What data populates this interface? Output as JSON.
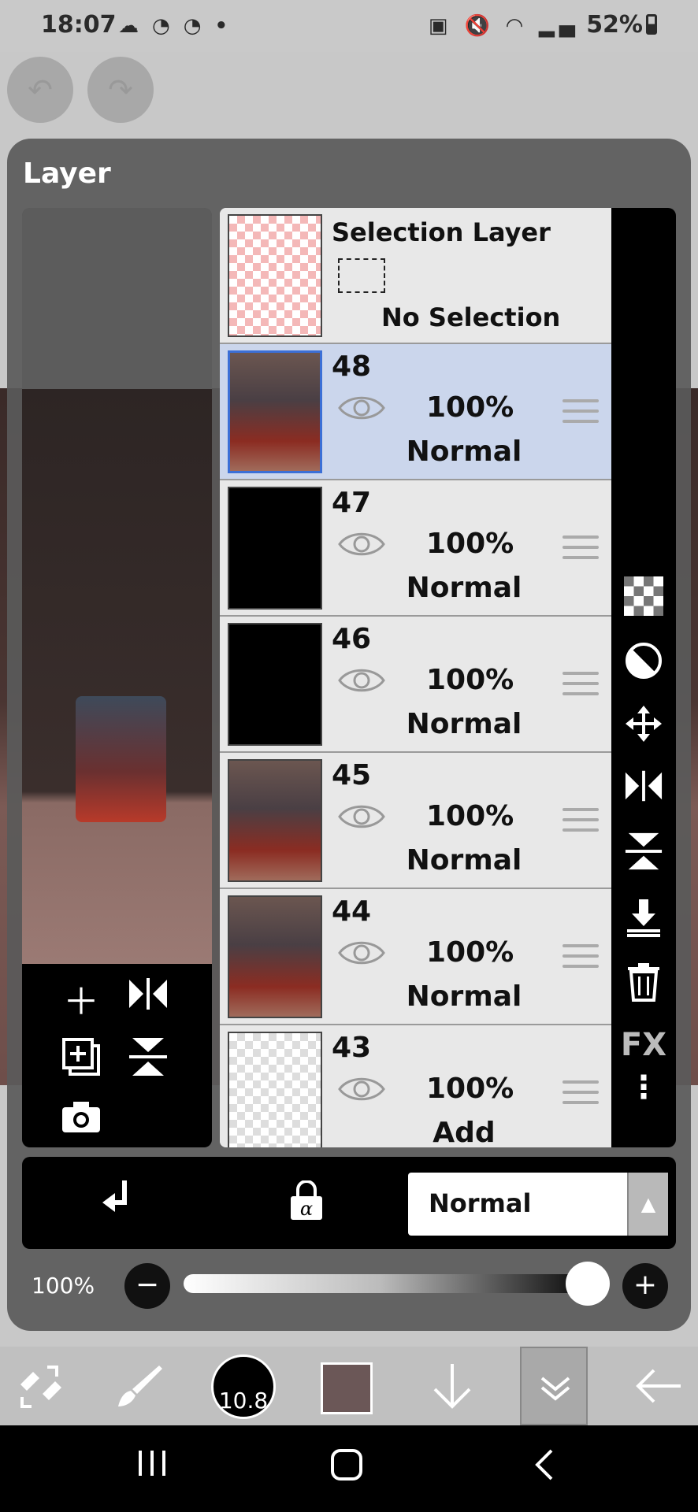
{
  "status_bar": {
    "time": "18:07",
    "left_icons": "☁ ◔ ◔ •",
    "right_icons": "▣ 🔇 ◠ ▂▄",
    "battery": "52%"
  },
  "panel": {
    "title": "Layer"
  },
  "selection_layer": {
    "title": "Selection Layer",
    "status": "No Selection"
  },
  "layers": [
    {
      "number": "48",
      "opacity": "100%",
      "blend": "Normal",
      "selected": true,
      "thumb": "art"
    },
    {
      "number": "47",
      "opacity": "100%",
      "blend": "Normal",
      "selected": false,
      "thumb": "black"
    },
    {
      "number": "46",
      "opacity": "100%",
      "blend": "Normal",
      "selected": false,
      "thumb": "black-art"
    },
    {
      "number": "45",
      "opacity": "100%",
      "blend": "Normal",
      "selected": false,
      "thumb": "art"
    },
    {
      "number": "44",
      "opacity": "100%",
      "blend": "Normal",
      "selected": false,
      "thumb": "art"
    },
    {
      "number": "43",
      "opacity": "100%",
      "blend": "Add",
      "selected": false,
      "thumb": "transparent"
    }
  ],
  "right_tools": {
    "fx_label": "FX",
    "icons": [
      "checker-icon",
      "half-circle-icon",
      "move-icon",
      "flip-horizontal-icon",
      "flip-vertical-icon",
      "merge-down-icon",
      "trash-icon",
      "fx-label",
      "more-icon"
    ]
  },
  "preview_tools": {
    "icons": [
      "add-layer-icon",
      "flip-horizontal-icon",
      "duplicate-layer-icon",
      "flip-vertical-icon",
      "camera-icon"
    ]
  },
  "bottom_bar": {
    "blend_mode": "Normal"
  },
  "opacity_slider": {
    "label": "100%",
    "value": 1.0
  },
  "toolbar": {
    "brush_size": "10.8",
    "color": "#6b5757"
  },
  "colors": {
    "panel_bg": "#5a5a5a",
    "selected_row": "#cbd6ec",
    "selected_border": "#3b6fd6"
  }
}
